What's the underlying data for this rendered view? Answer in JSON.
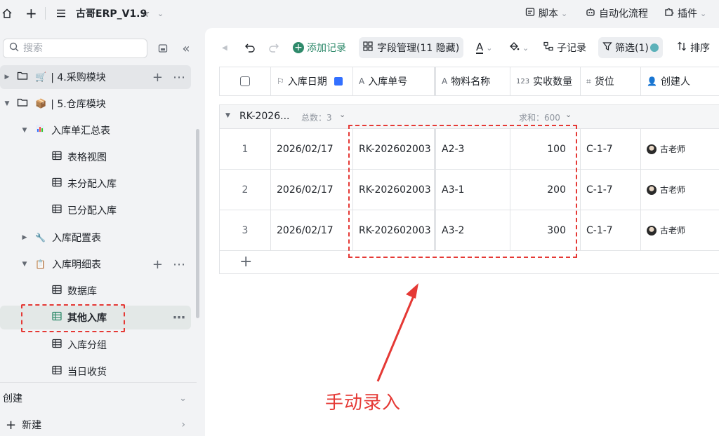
{
  "topbar": {
    "app_title": "古哥ERP_V1.9",
    "script_label": "脚本",
    "automation_label": "自动化流程",
    "plugin_label": "插件"
  },
  "sidebar": {
    "search_placeholder": "搜索",
    "tree": [
      {
        "label": "| 4.采购模块",
        "level": 0
      },
      {
        "label": "| 5.仓库模块",
        "level": 0
      },
      {
        "label": "入库单汇总表",
        "level": 1
      },
      {
        "label": "表格视图",
        "level": 2
      },
      {
        "label": "未分配入库",
        "level": 2
      },
      {
        "label": "已分配入库",
        "level": 2
      },
      {
        "label": "入库配置表",
        "level": 1
      },
      {
        "label": "入库明细表",
        "level": 1
      },
      {
        "label": "数据库",
        "level": 2
      },
      {
        "label": "其他入库",
        "level": 2,
        "active": true
      },
      {
        "label": "入库分组",
        "level": 2
      },
      {
        "label": "当日收货",
        "level": 2
      }
    ],
    "create_label": "创建",
    "new_label": "新建"
  },
  "toolbar": {
    "add_record": "添加记录",
    "field_manage": "字段管理(11 隐藏)",
    "sub_record": "子记录",
    "filter": "筛选(1)",
    "sort": "排序"
  },
  "table": {
    "columns": [
      "入库日期",
      "入库单号",
      "物料名称",
      "实收数量",
      "货位",
      "创建人"
    ],
    "group": {
      "name": "RK-2026...",
      "count_label": "总数：3",
      "sum_label": "求和：600"
    },
    "rows": [
      {
        "index": "1",
        "date": "2026/02/17",
        "order": "RK-202602003",
        "material": "A2-3",
        "qty": "100",
        "location": "C-1-7",
        "creator": "古老师"
      },
      {
        "index": "2",
        "date": "2026/02/17",
        "order": "RK-202602003",
        "material": "A3-1",
        "qty": "200",
        "location": "C-1-7",
        "creator": "古老师"
      },
      {
        "index": "3",
        "date": "2026/02/17",
        "order": "RK-202602003",
        "material": "A3-2",
        "qty": "300",
        "location": "C-1-7",
        "creator": "古老师"
      }
    ]
  },
  "annotation": {
    "text": "手动录入",
    "color": "#e53935"
  },
  "colors": {
    "accent": "#2f8a6b",
    "annotation_red": "#e53935"
  }
}
